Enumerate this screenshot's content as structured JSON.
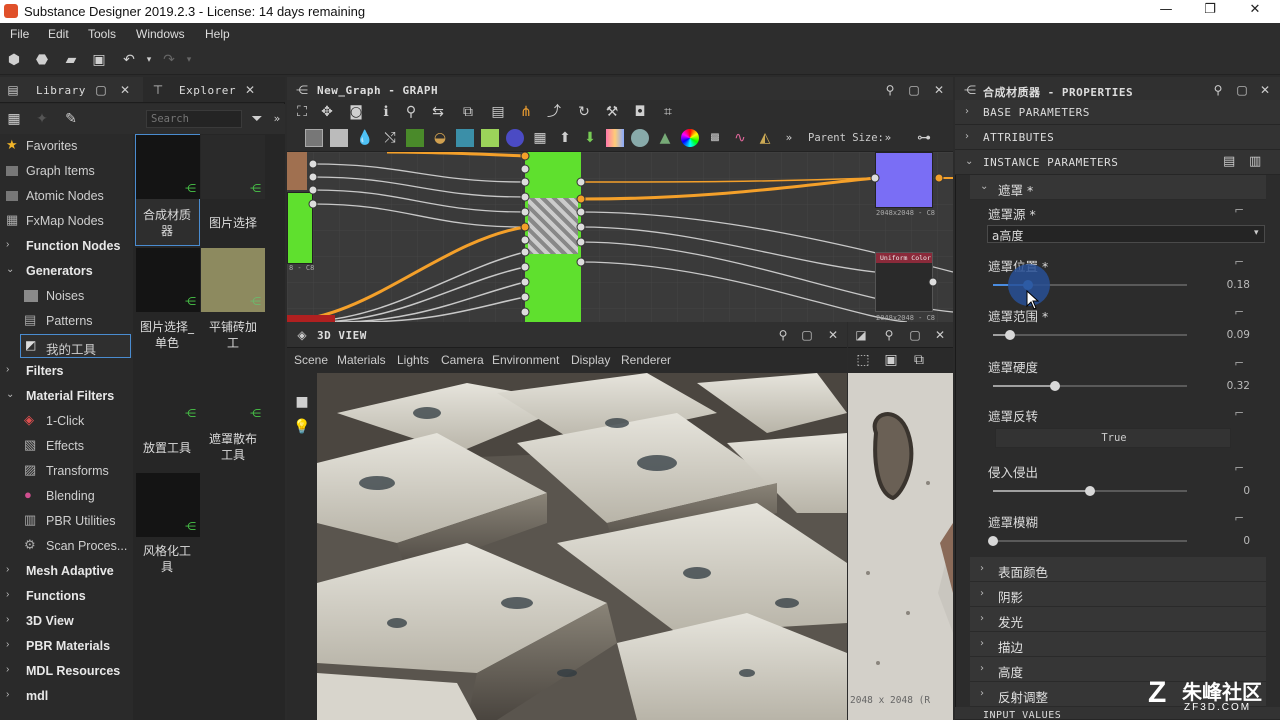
{
  "window": {
    "title": "Substance Designer 2019.2.3 - License: 14 days remaining"
  },
  "menu": [
    "File",
    "Edit",
    "Tools",
    "Windows",
    "Help"
  ],
  "library": {
    "tab_library": "Library",
    "tab_explorer": "Explorer",
    "search_placeholder": "Search",
    "tree": [
      {
        "label": "Favorites",
        "type": "star"
      },
      {
        "label": "Graph Items",
        "type": "icon"
      },
      {
        "label": "Atomic Nodes",
        "type": "icon"
      },
      {
        "label": "FxMap Nodes",
        "type": "icon"
      },
      {
        "label": "Function Nodes",
        "type": "collapsed"
      },
      {
        "label": "Generators",
        "type": "expanded"
      },
      {
        "label": "Noises",
        "type": "child"
      },
      {
        "label": "Patterns",
        "type": "child"
      },
      {
        "label": "我的工具",
        "type": "child-selected"
      },
      {
        "label": "Filters",
        "type": "collapsed"
      },
      {
        "label": "Material Filters",
        "type": "expanded"
      },
      {
        "label": "1-Click",
        "type": "child"
      },
      {
        "label": "Effects",
        "type": "child"
      },
      {
        "label": "Transforms",
        "type": "child"
      },
      {
        "label": "Blending",
        "type": "child"
      },
      {
        "label": "PBR Utilities",
        "type": "child"
      },
      {
        "label": "Scan Proces...",
        "type": "child"
      },
      {
        "label": "Mesh Adaptive",
        "type": "collapsed"
      },
      {
        "label": "Functions",
        "type": "collapsed"
      },
      {
        "label": "3D View",
        "type": "collapsed"
      },
      {
        "label": "PBR Materials",
        "type": "collapsed"
      },
      {
        "label": "MDL Resources",
        "type": "collapsed"
      },
      {
        "label": "mdl",
        "type": "collapsed"
      }
    ],
    "items": [
      {
        "caption": "合成材质\n器"
      },
      {
        "caption": "图片选择"
      },
      {
        "caption": "图片选择_\n单色"
      },
      {
        "caption": "平铺砖加\n工"
      },
      {
        "caption": "放置工具"
      },
      {
        "caption": "遮罩散布\n工具"
      },
      {
        "caption": "风格化工\n具"
      }
    ]
  },
  "graph": {
    "title": "New_Graph - GRAPH",
    "parent_size_label": "Parent Size:",
    "node_res_1": "2048x2048 - C8",
    "node_res_2": "2048x2048 - C8",
    "node_label_uniform": "Uniform Color",
    "node_res_left": "8 - C8"
  },
  "view3d": {
    "title": "3D VIEW",
    "menu": [
      "Scene",
      "Materials",
      "Lights",
      "Camera",
      "Environment",
      "Display",
      "Renderer"
    ]
  },
  "view2d": {
    "size_text": "2048 x 2048 (R"
  },
  "properties": {
    "title": "合成材质器 - PROPERTIES",
    "sections": {
      "base": "BASE PARAMETERS",
      "attributes": "ATTRIBUTES",
      "instance": "INSTANCE PARAMETERS",
      "input_values": "INPUT VALUES"
    },
    "group_mask": "遮罩 *",
    "mask_type_label": "遮罩源 *",
    "mask_type_value": "a高度",
    "params": [
      {
        "label": "遮罩位置 *",
        "value": "0.18",
        "frac": 0.18
      },
      {
        "label": "遮罩范围 *",
        "value": "0.09",
        "frac": 0.09
      },
      {
        "label": "遮罩硬度",
        "value": "0.32",
        "frac": 0.32
      },
      {
        "label": "侵入侵出",
        "value": "0",
        "frac": 0.5
      },
      {
        "label": "遮罩模糊",
        "value": "0",
        "frac": 0.0
      }
    ],
    "invert_label": "遮罩反转",
    "invert_value": "True",
    "groups": [
      "表面颜色",
      "阴影",
      "发光",
      "描边",
      "高度",
      "反射调整"
    ]
  },
  "watermark": {
    "brand": "朱峰社区",
    "url": "ZF3D.COM"
  }
}
